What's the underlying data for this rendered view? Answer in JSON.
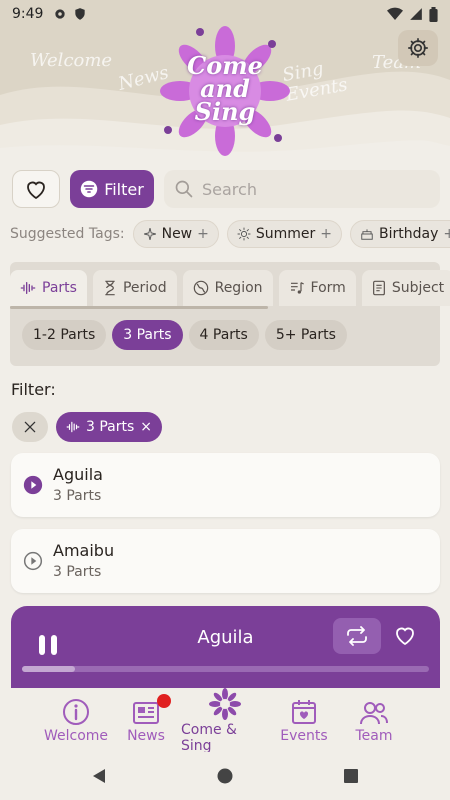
{
  "status_bar": {
    "time": "9:49"
  },
  "header": {
    "logo_lines": [
      "Come",
      "and",
      "Sing"
    ],
    "faded_words": [
      "Welcome",
      "News",
      "Sing Events",
      "Team"
    ]
  },
  "search": {
    "filter_label": "Filter",
    "placeholder": "Search"
  },
  "suggested_tags": {
    "label": "Suggested Tags:",
    "items": [
      {
        "label": "New",
        "icon": "sparkle-icon"
      },
      {
        "label": "Summer",
        "icon": "sun-icon"
      },
      {
        "label": "Birthday",
        "icon": "cake-icon"
      }
    ]
  },
  "category_tabs": [
    {
      "label": "Parts",
      "icon": "soundwave-icon",
      "active": true
    },
    {
      "label": "Period",
      "icon": "hourglass-icon",
      "active": false
    },
    {
      "label": "Region",
      "icon": "globe-icon",
      "active": false
    },
    {
      "label": "Form",
      "icon": "music-note-icon",
      "active": false
    },
    {
      "label": "Subject",
      "icon": "document-icon",
      "active": false
    }
  ],
  "part_options": [
    {
      "label": "1-2 Parts",
      "selected": false
    },
    {
      "label": "3 Parts",
      "selected": true
    },
    {
      "label": "4 Parts",
      "selected": false
    },
    {
      "label": "5+ Parts",
      "selected": false
    }
  ],
  "filter_section": {
    "label": "Filter:",
    "active_filter": "3 Parts"
  },
  "songs": [
    {
      "title": "Aguila",
      "subtitle": "3 Parts",
      "playing": true
    },
    {
      "title": "Amaibu",
      "subtitle": "3 Parts",
      "playing": false
    }
  ],
  "player": {
    "title": "Aguila",
    "progress": 0.13
  },
  "bottom_nav": [
    {
      "label": "Welcome",
      "icon": "info-icon"
    },
    {
      "label": "News",
      "icon": "newspaper-icon",
      "badge": true
    },
    {
      "label": "Come & Sing",
      "icon": "flower-logo-icon",
      "active": true
    },
    {
      "label": "Events",
      "icon": "calendar-heart-icon"
    },
    {
      "label": "Team",
      "icon": "people-icon"
    }
  ],
  "colors": {
    "accent": "#7b3f98",
    "background": "#f1eee8",
    "header": "#dcd5c6",
    "badge": "#e02020"
  }
}
